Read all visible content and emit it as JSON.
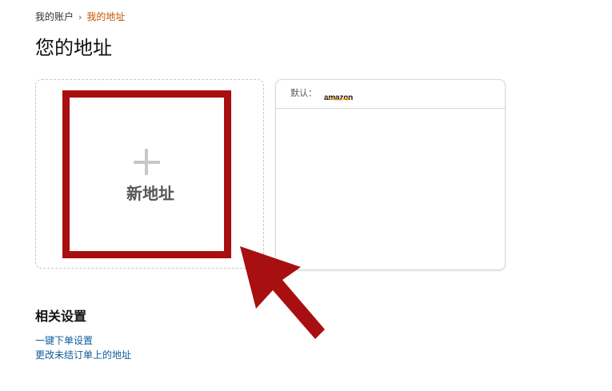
{
  "breadcrumb": {
    "parent": "我的账户",
    "separator": "›",
    "current": "我的地址"
  },
  "page": {
    "title": "您的地址"
  },
  "add_card": {
    "label": "新地址",
    "icon": "plus-icon"
  },
  "default_card": {
    "label": "默认：",
    "logo_text": "amazon"
  },
  "related_settings": {
    "title": "相关设置",
    "links": [
      "一键下单设置",
      "更改未结订单上的地址"
    ]
  },
  "colors": {
    "highlight": "#a80f10",
    "breadcrumb_current": "#c45500",
    "link": "#0f5c9c",
    "logo_smile": "#ff9900"
  }
}
